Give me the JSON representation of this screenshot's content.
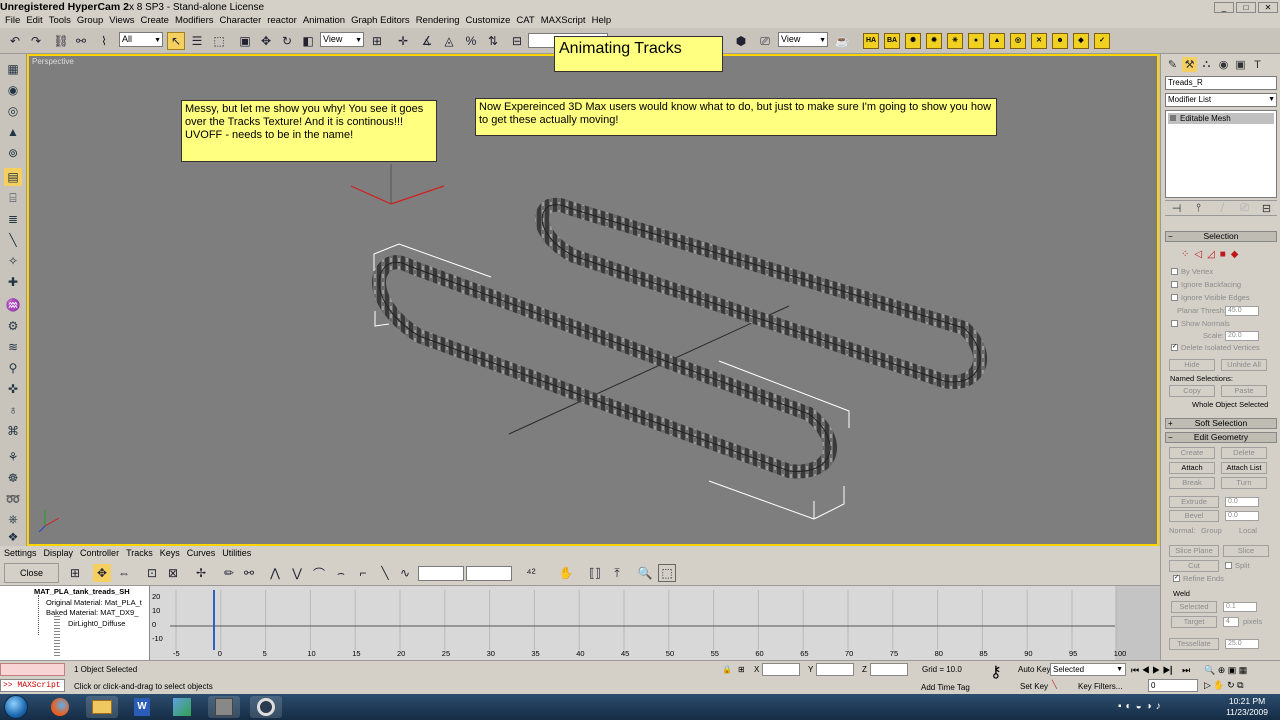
{
  "window": {
    "title_prefix": "Unregistered HyperCam 2",
    "title_rest": "x 8 SP3 - Stand-alone License",
    "minimize": "_",
    "maximize": "□",
    "close": "✕"
  },
  "menubar": [
    "File",
    "Edit",
    "Tools",
    "Group",
    "Views",
    "Create",
    "Modifiers",
    "Character",
    "reactor",
    "Animation",
    "Graph Editors",
    "Rendering",
    "Customize",
    "CAT",
    "MAXScript",
    "Help"
  ],
  "toolbar": {
    "selection_filter": "All",
    "ref_coord": "View",
    "view_combo_right": "View"
  },
  "viewport": {
    "label": "Perspective",
    "title_note": "Animating Tracks",
    "note_left": "Messy, but let me show you why! You see it goes over the Tracks Texture! And it is continous!!!\nUVOFF - needs to be in the name!",
    "note_right": "Now Expereinced 3D Max users would know what to do, but just to make sure I'm going to show you how to get these actually moving!"
  },
  "command_panel": {
    "object_name": "Treads_R",
    "modifier_list": "Modifier List",
    "stack_item": "Editable Mesh",
    "selection_rollout": "Selection",
    "by_vertex": "By Vertex",
    "ignore_backfacing": "Ignore Backfacing",
    "ignore_visible_edges": "Ignore Visible Edges",
    "planar_thresh_label": "Planar Thresh:",
    "planar_thresh": "45.0",
    "show_normals": "Show Normals",
    "scale_label": "Scale:",
    "scale": "20.0",
    "delete_isolated": "Delete Isolated Vertices",
    "hide": "Hide",
    "unhide_all": "Unhide All",
    "named_selections": "Named Selections:",
    "copy": "Copy",
    "paste": "Paste",
    "whole_object_selected": "Whole Object Selected",
    "soft_selection": "Soft Selection",
    "edit_geometry": "Edit Geometry",
    "create": "Create",
    "delete": "Delete",
    "attach": "Attach",
    "attach_list": "Attach List",
    "break": "Break",
    "turn": "Turn",
    "extrude": "Extrude",
    "extrude_val": "0.0",
    "bevel": "Bevel",
    "bevel_val": "0.0",
    "normal_label": "Normal:",
    "group": "Group",
    "local": "Local",
    "slice_plane": "Slice Plane",
    "slice": "Slice",
    "cut": "Cut",
    "split": "Split",
    "refine_ends": "Refine Ends",
    "weld": "Weld",
    "selected": "Selected",
    "selected_val": "0.1",
    "target": "Target",
    "target_val": "4",
    "pixels": "pixels",
    "tessellate": "Tessellate",
    "tessellate_val": "25.0"
  },
  "trackview": {
    "menu": [
      "Settings",
      "Display",
      "Controller",
      "Tracks",
      "Keys",
      "Curves",
      "Utilities"
    ],
    "close": "Close",
    "tree": [
      "MAT_PLA_tank_treads_SH",
      "Original Material: Mat_PLA_t",
      "Baked Material: MAT_DX9_",
      "DirLight0_Diffuse"
    ],
    "y_ticks": [
      "20",
      "10",
      "0",
      "-10"
    ],
    "x_ticks": [
      "-5",
      "0",
      "5",
      "10",
      "15",
      "20",
      "25",
      "30",
      "35",
      "40",
      "45",
      "50",
      "55",
      "60",
      "65",
      "70",
      "75",
      "80",
      "85",
      "90",
      "95",
      "100"
    ]
  },
  "status": {
    "maxscript": ">> MAXScript",
    "objects_selected": "1 Object Selected",
    "prompt": "Click or click-and-drag to select objects",
    "x_label": "X",
    "y_label": "Y",
    "z_label": "Z",
    "grid": "Grid = 10.0",
    "add_time_tag": "Add Time Tag",
    "auto_key": "Auto Key",
    "set_key": "Set Key",
    "selected_combo": "Selected",
    "key_filters": "Key Filters...",
    "frame": "0"
  },
  "taskbar": {
    "time": "10:21 PM",
    "date": "11/23/2009"
  },
  "colors": {
    "viewport_bg": "#7e7e7e",
    "active_border": "#ffd400",
    "note_bg": "#ffff80"
  }
}
